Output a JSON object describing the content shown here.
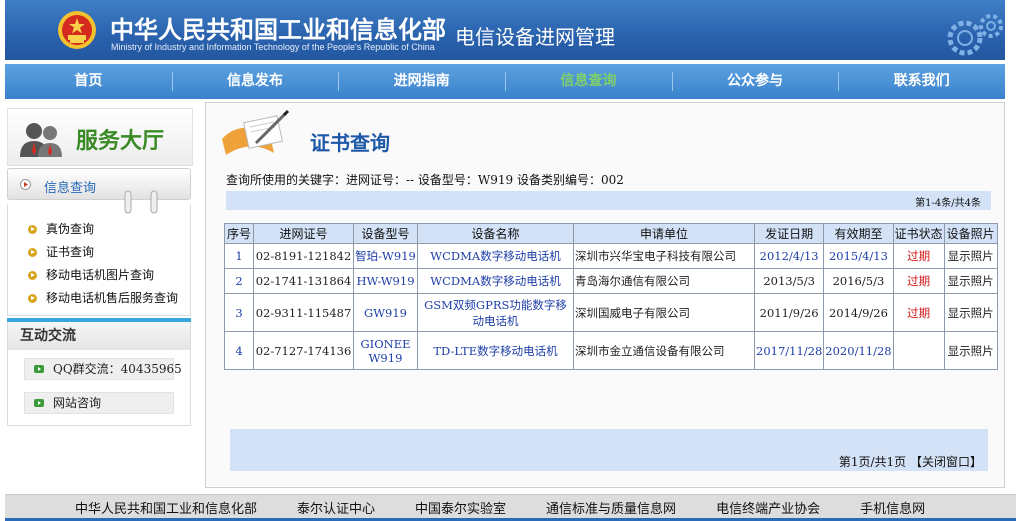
{
  "header": {
    "ministry_cn": "中华人民共和国工业和信息化部",
    "ministry_en": "Ministry of Industry and Information Technology of the People's Republic of China",
    "site_name": "电信设备进网管理"
  },
  "nav": {
    "items": [
      "首页",
      "信息发布",
      "进网指南",
      "信息查询",
      "公众参与",
      "联系我们"
    ],
    "active": "信息查询"
  },
  "sidebar": {
    "hall_title": "服务大厅",
    "tab_label": "信息查询",
    "links": [
      "真伪查询",
      "证书查询",
      "移动电话机图片查询",
      "移动电话机售后服务查询"
    ],
    "interact_title": "互动交流",
    "qq": "QQ群交流：40435965",
    "consult": "网站咨询"
  },
  "main": {
    "title": "证书查询",
    "query_text": "查询所使用的关键字：进网证号：-- 设备型号：W919 设备类别编号：002",
    "count_text": "第1-4条/共4条",
    "page_info": "第1页/共1页 【关闭窗口】"
  },
  "table": {
    "headers": [
      "序号",
      "进网证号",
      "设备型号",
      "设备名称",
      "申请单位",
      "发证日期",
      "有效期至",
      "证书状态",
      "设备照片"
    ],
    "rows": [
      [
        "1",
        "02-8191-121842",
        "智珀-W919",
        "WCDMA数字移动电话机",
        "深圳市兴华宝电子科技有限公司",
        "2012/4/13",
        "2015/4/13",
        "过期",
        "显示照片"
      ],
      [
        "2",
        "02-1741-131864",
        "HW-W919",
        "WCDMA数字移动电话机",
        "青岛海尔通信有限公司",
        "2013/5/3",
        "2016/5/3",
        "过期",
        "显示照片"
      ],
      [
        "3",
        "02-9311-115487",
        "GW919",
        "GSM双频GPRS功能数字移动电话机",
        "深圳国威电子有限公司",
        "2011/9/26",
        "2014/9/26",
        "过期",
        "显示照片"
      ],
      [
        "4",
        "02-7127-174136",
        "GIONEE W919",
        "TD-LTE数字移动电话机",
        "深圳市金立通信设备有限公司",
        "2017/11/28",
        "2020/11/28",
        "",
        "显示照片"
      ]
    ]
  },
  "footer": {
    "links": [
      "中华人民共和国工业和信息化部",
      "泰尔认证中心",
      "中国泰尔实验室",
      "通信标准与质量信息网",
      "电信终端产业协会",
      "手机信息网"
    ]
  },
  "colors": {
    "header_blue": "#2a62ad",
    "nav_active": "#7fd06a",
    "hall_green": "#3a8a26",
    "title_blue": "#1d58a8",
    "expired_red": "#d41616",
    "table_header_bg": "#d3e2f6"
  }
}
